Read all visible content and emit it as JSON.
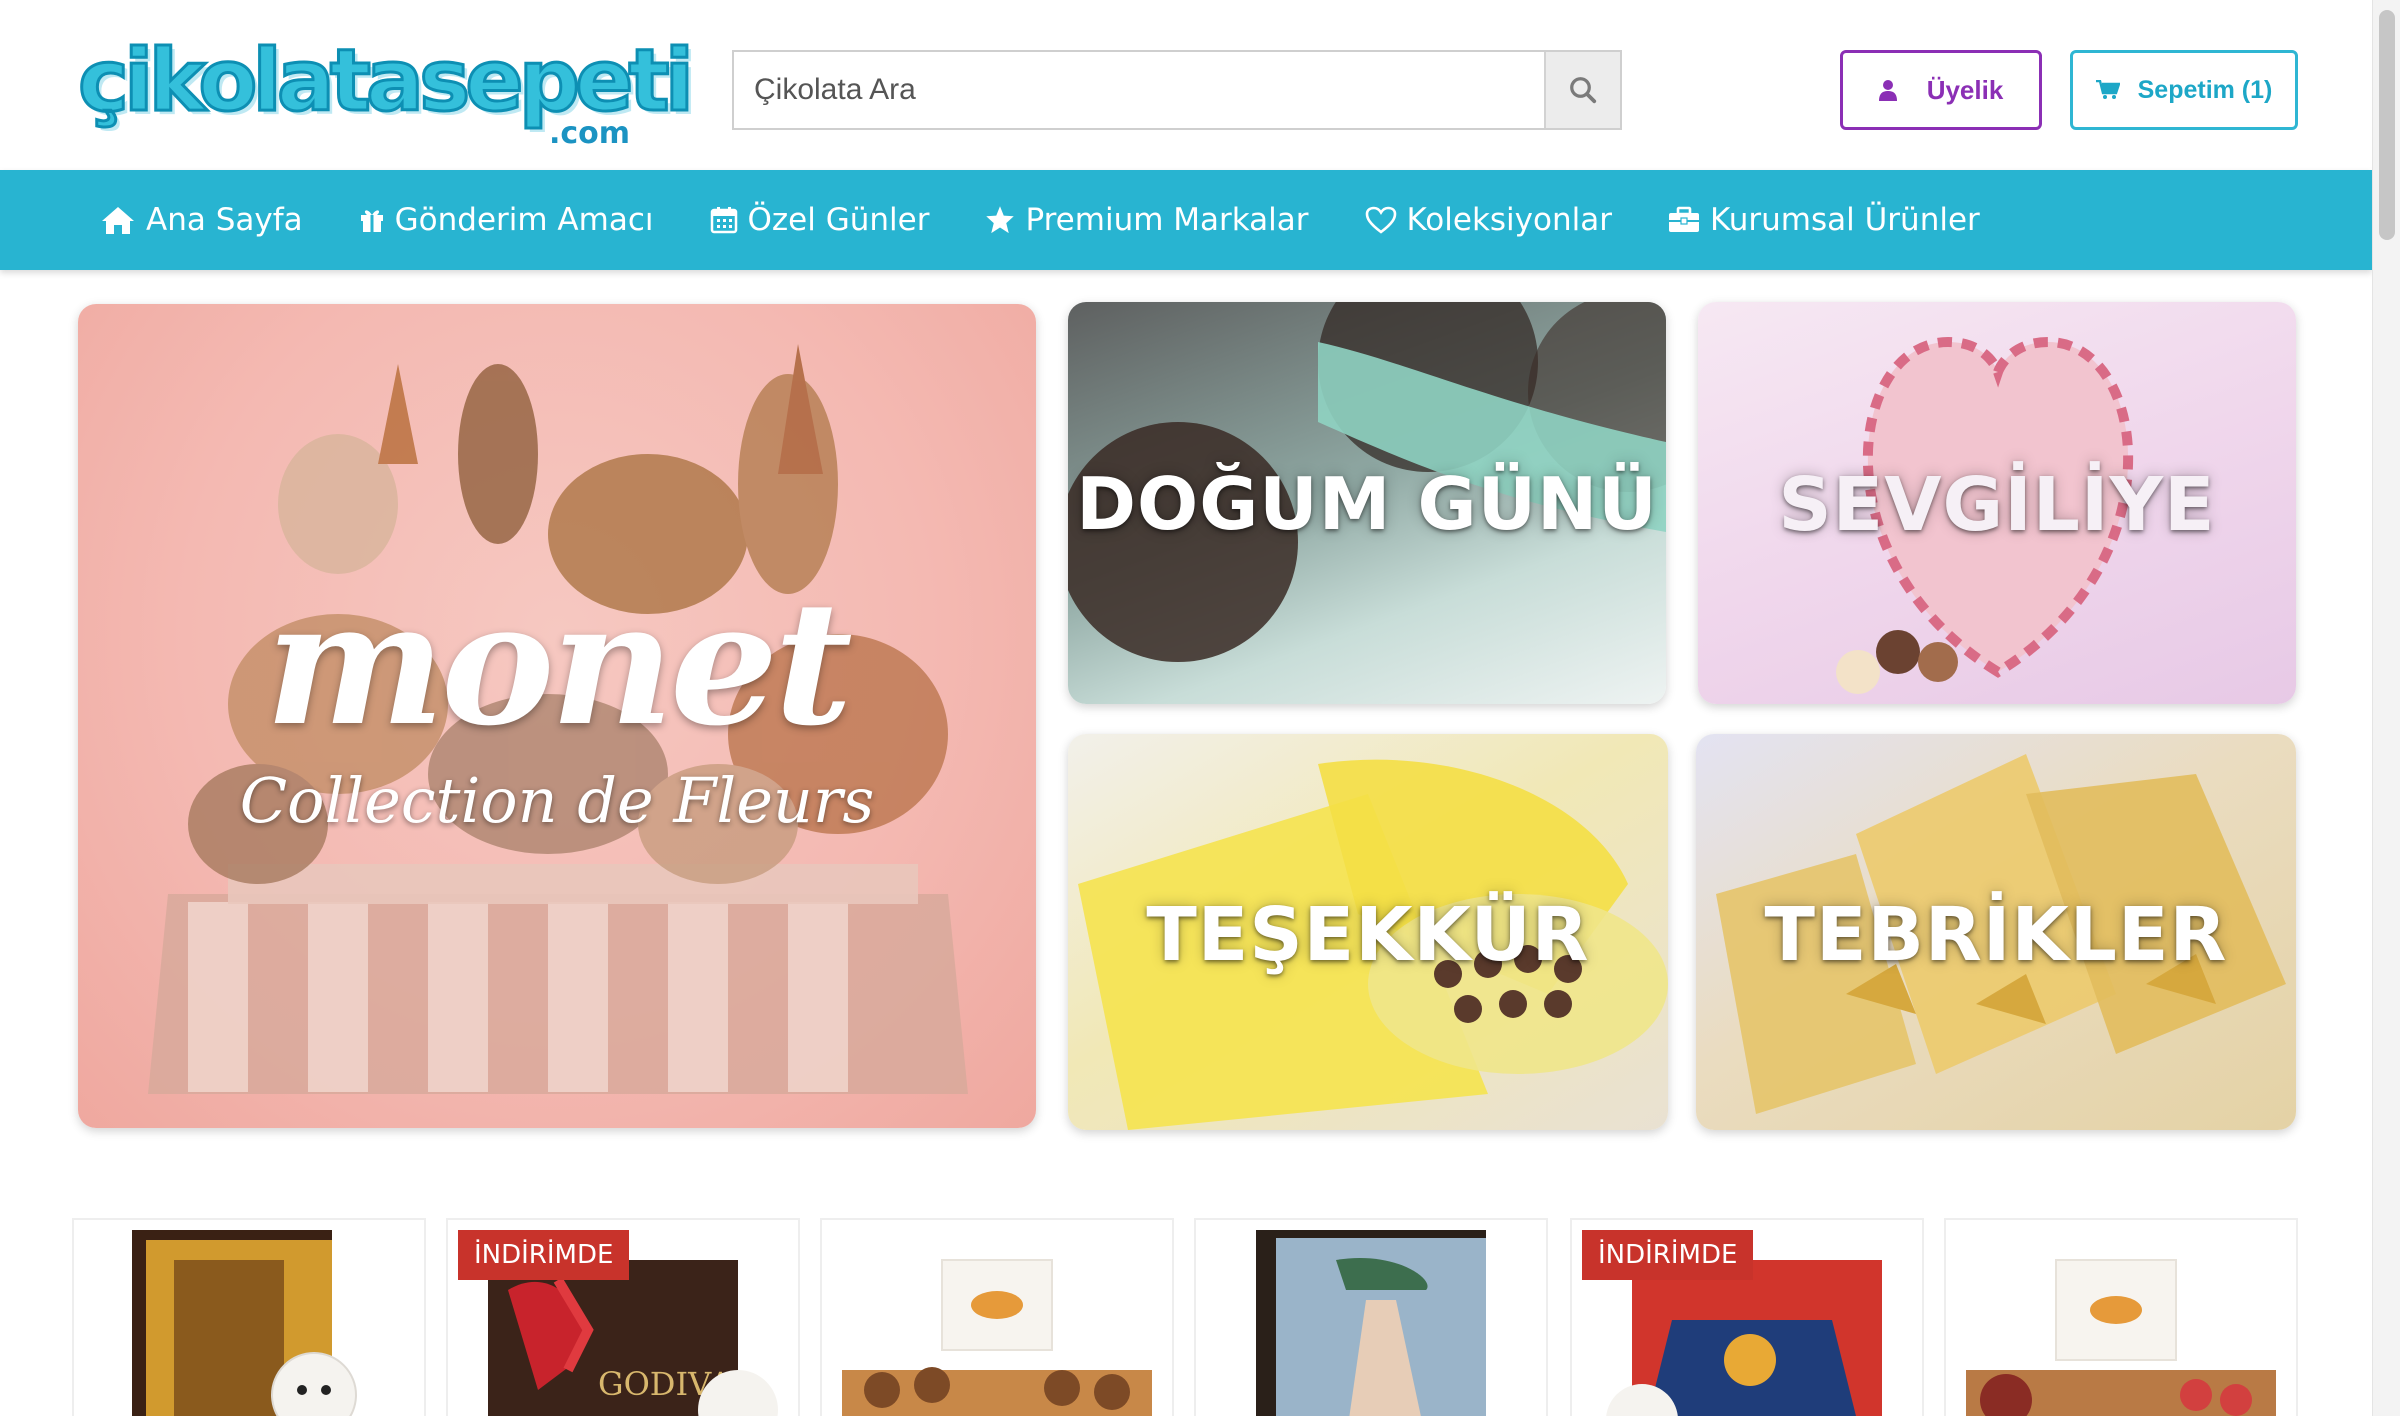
{
  "header": {
    "logo_text": "çikolatasepeti",
    "logo_suffix": ".com",
    "search_placeholder": "Çikolata Ara",
    "membership_label": "Üyelik",
    "cart_label": "Sepetim (1)"
  },
  "nav": {
    "items": [
      {
        "label": "Ana Sayfa",
        "icon": "home-icon"
      },
      {
        "label": "Gönderim Amacı",
        "icon": "gift-icon"
      },
      {
        "label": "Özel Günler",
        "icon": "calendar-icon"
      },
      {
        "label": "Premium Markalar",
        "icon": "star-icon"
      },
      {
        "label": "Koleksiyonlar",
        "icon": "heart-icon"
      },
      {
        "label": "Kurumsal Ürünler",
        "icon": "briefcase-icon"
      }
    ]
  },
  "banners": {
    "monet_title": "monet",
    "monet_subtitle": "Collection de Fleurs",
    "birthday": "DOĞUM GÜNÜ",
    "valentine": "SEVGİLİYE",
    "thanks": "TEŞEKKÜR",
    "congrats": "TEBRİKLER"
  },
  "products": {
    "badge_label": "İNDİRİMDE",
    "godiva_text": "GODIVA"
  },
  "colors": {
    "brand_teal": "#28b4d1",
    "membership_purple": "#8b2fb5",
    "sale_red": "#c8332b"
  }
}
